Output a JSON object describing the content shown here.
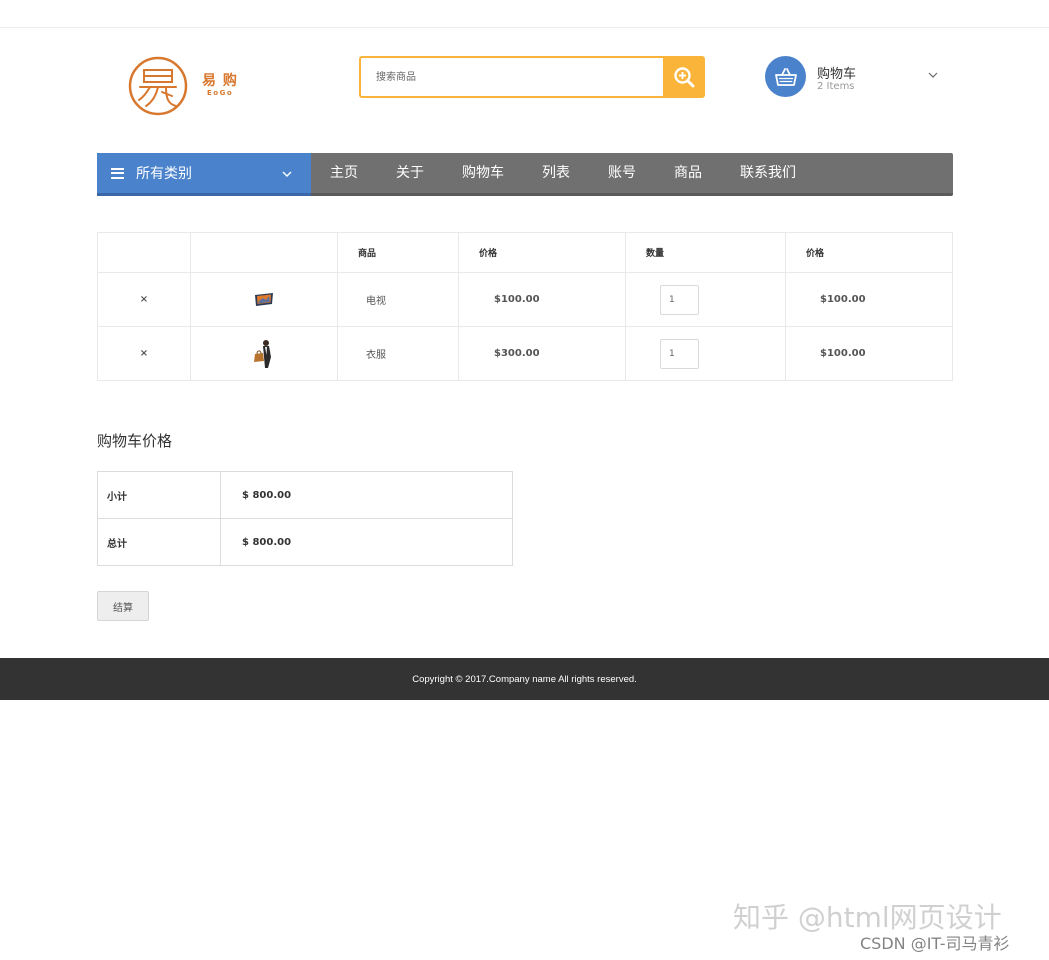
{
  "header": {
    "logo_text": "易 购",
    "logo_sub": "EoGo",
    "search_placeholder": "搜索商品",
    "cart_title": "购物车",
    "cart_count": "2 Items"
  },
  "nav": {
    "category_label": "所有类别",
    "items": [
      "主页",
      "关于",
      "购物车",
      "列表",
      "账号",
      "商品",
      "联系我们"
    ]
  },
  "cart_table": {
    "headers": [
      "",
      "",
      "商品",
      "价格",
      "数量",
      "价格"
    ],
    "rows": [
      {
        "remove": "×",
        "thumb": "tv-thumbnail-icon",
        "name": "电视",
        "price": "$100.00",
        "qty": "1",
        "total": "$100.00"
      },
      {
        "remove": "×",
        "thumb": "clothes-thumbnail-icon",
        "name": "衣服",
        "price": "$300.00",
        "qty": "1",
        "total": "$100.00"
      }
    ]
  },
  "totals": {
    "title": "购物车价格",
    "subtotal_label": "小计",
    "subtotal_value": "$ 800.00",
    "total_label": "总计",
    "total_value": "$ 800.00"
  },
  "checkout_label": "结算",
  "footer": {
    "copyright": "Copyright © 2017.Company name All rights reserved."
  },
  "watermark": {
    "line1": "知乎 @html网页设计",
    "line2": "CSDN @IT-司马青衫"
  },
  "colors": {
    "accent_orange": "#fbb43a",
    "brand_blue": "#4a82cc",
    "logo_orange": "#d8782f",
    "nav_gray": "#707070",
    "footer_dark": "#333333"
  },
  "icons": {
    "search": "magnifier-plus-icon",
    "cart": "basket-icon",
    "chevron": "chevron-down-icon",
    "menu": "hamburger-icon"
  }
}
